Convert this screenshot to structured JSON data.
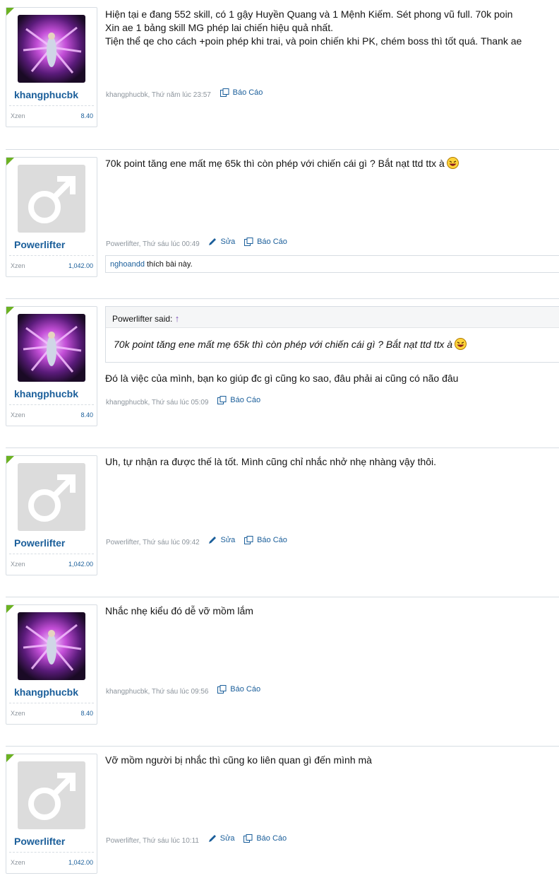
{
  "meta_labels": {
    "edit": "Sửa",
    "report": "Báo Cáo"
  },
  "posts": [
    {
      "user": "khangphucbk",
      "xzen_label": "Xzen",
      "xzen_value": "8.40",
      "avatar": "game-avatar",
      "lines": [
        "Hiện tại e đang 552 skill, có 1 gậy Huyền Quang và 1 Mệnh Kiếm. Sét phong vũ full. 70k poin",
        "Xin ae 1 bảng skill MG phép lai chiến hiệu quả nhất.",
        "Tiện thể qe cho cách +poin phép khi trai, và poin chiến khi PK, chém boss thì tốt quá. Thank ae"
      ],
      "timestamp": "khangphucbk, Thứ năm lúc 23:57"
    },
    {
      "user": "Powerlifter",
      "xzen_label": "Xzen",
      "xzen_value": "1,042.00",
      "avatar": "male-avatar",
      "lines": [
        "70k point tăng ene mất mẹ 65k thì còn phép với chiến cái gì ? Bắt nạt ttd ttx à"
      ],
      "timestamp": "Powerlifter, Thứ sáu lúc 00:49",
      "likes_user": "nghoandd",
      "likes_text": " thích bài này."
    },
    {
      "user": "khangphucbk",
      "xzen_label": "Xzen",
      "xzen_value": "8.40",
      "avatar": "game-avatar",
      "quote_author": "Powerlifter said:",
      "quote_text": "70k point tăng ene mất mẹ 65k thì còn phép với chiến cái gì ? Bắt nạt ttd ttx à",
      "lines": [
        "Đó là việc của mình, bạn ko giúp đc gì cũng ko sao, đâu phải ai cũng có não đâu"
      ],
      "timestamp": "khangphucbk, Thứ sáu lúc 05:09"
    },
    {
      "user": "Powerlifter",
      "xzen_label": "Xzen",
      "xzen_value": "1,042.00",
      "avatar": "male-avatar",
      "lines": [
        "Uh, tự nhận ra được thế là tốt. Mình cũng chỉ nhắc nhở nhẹ nhàng vậy thôi."
      ],
      "timestamp": "Powerlifter, Thứ sáu lúc 09:42"
    },
    {
      "user": "khangphucbk",
      "xzen_label": "Xzen",
      "xzen_value": "8.40",
      "avatar": "game-avatar",
      "lines": [
        "Nhắc nhẹ kiểu đó dễ vỡ mồm lắm"
      ],
      "timestamp": "khangphucbk, Thứ sáu lúc 09:56"
    },
    {
      "user": "Powerlifter",
      "xzen_label": "Xzen",
      "xzen_value": "1,042.00",
      "avatar": "male-avatar",
      "lines": [
        "Vỡ mồm người bị nhắc thì cũng ko liên quan gì đến mình mà"
      ],
      "timestamp": "Powerlifter, Thứ sáu lúc 10:11"
    }
  ]
}
